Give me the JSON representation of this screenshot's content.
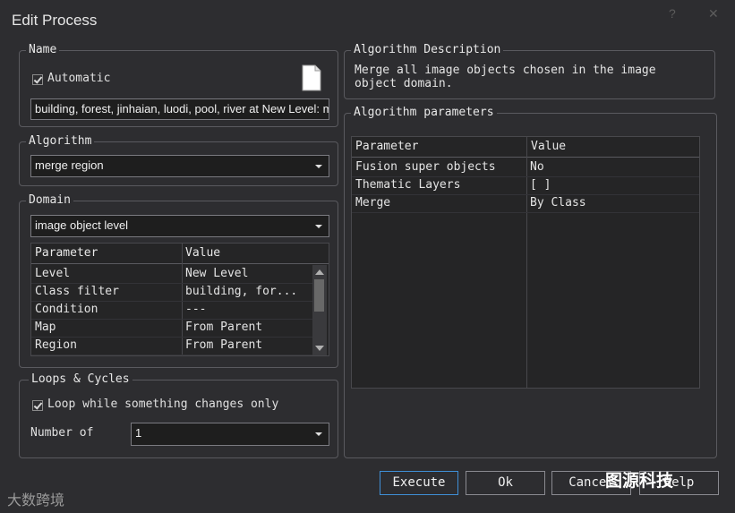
{
  "window": {
    "title": "Edit Process",
    "help_glyph": "?",
    "close_glyph": "✕"
  },
  "name_group": {
    "legend": "Name",
    "automatic_label": "Automatic",
    "automatic_checked": true,
    "name_value": "building, forest, jinhaian, luodi, pool, river at  New Level: merg"
  },
  "algorithm_group": {
    "legend": "Algorithm",
    "selected": "merge region"
  },
  "domain_group": {
    "legend": "Domain",
    "selected": "image object level",
    "columns": [
      "Parameter",
      "Value"
    ],
    "rows": [
      {
        "param": "Level",
        "value": "New Level"
      },
      {
        "param": "Class filter",
        "value": "building, for..."
      },
      {
        "param": "Condition",
        "value": "---"
      },
      {
        "param": "Map",
        "value": "From Parent"
      },
      {
        "param": "Region",
        "value": "From Parent"
      }
    ]
  },
  "loops_group": {
    "legend": "Loops & Cycles",
    "loop_label": "Loop while something changes only",
    "loop_checked": true,
    "number_label": "Number of",
    "number_value": "1"
  },
  "description_group": {
    "legend": "Algorithm Description",
    "text_line1": "Merge all image objects chosen in the image",
    "text_line2": "object domain."
  },
  "parameters_group": {
    "legend": "Algorithm parameters",
    "columns": [
      "Parameter",
      "Value"
    ],
    "rows": [
      {
        "param": "Fusion super objects",
        "value": "No"
      },
      {
        "param": "Thematic Layers",
        "value": "[  ]"
      },
      {
        "param": "Merge",
        "value": "By Class"
      }
    ]
  },
  "buttons": {
    "execute": "Execute",
    "ok": "Ok",
    "cancel": "Cancel",
    "help": "Help"
  },
  "watermarks": {
    "left": "大数跨境",
    "right": "图源科技"
  },
  "colors": {
    "background": "#2d2d30",
    "field": "#1e1e1e",
    "accent": "#3f8fd6",
    "border": "#5a5a5f"
  }
}
